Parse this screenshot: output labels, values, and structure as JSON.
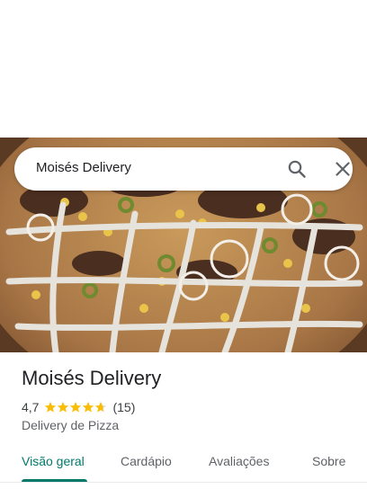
{
  "search": {
    "query": "Moisés Delivery"
  },
  "place": {
    "name": "Moisés Delivery",
    "rating": "4,7",
    "rating_value": 4.7,
    "stars_max": 5,
    "review_count": "(15)",
    "category": "Delivery de Pizza"
  },
  "tabs": [
    {
      "label": "Visão geral",
      "active": true
    },
    {
      "label": "Cardápio",
      "active": false
    },
    {
      "label": "Avaliações",
      "active": false
    },
    {
      "label": "Sobre",
      "active": false
    }
  ],
  "colors": {
    "accent": "#00796b",
    "star": "#fbbc04"
  },
  "icons": {
    "search": "search-icon",
    "close": "close-icon",
    "star": "star-icon"
  }
}
